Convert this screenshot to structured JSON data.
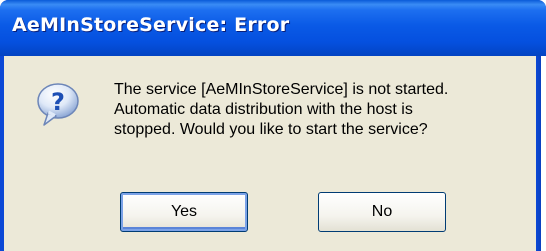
{
  "window": {
    "title": "AeMInStoreService: Error"
  },
  "dialog": {
    "icon": "question-icon",
    "message_lines": [
      "The service [AeMInStoreService] is not started.",
      "Automatic data distribution with the host is",
      "stopped.  Would you like to start the service?"
    ]
  },
  "buttons": {
    "yes_label": "Yes",
    "no_label": "No"
  },
  "colors": {
    "titlebar": "#0a5ae6",
    "client": "#ece9d8",
    "button_border": "#003c74"
  }
}
